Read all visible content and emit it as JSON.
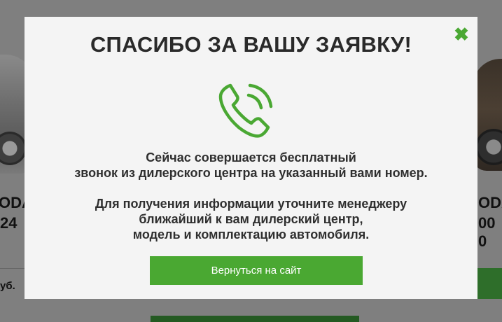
{
  "background": {
    "left_model": "ODA",
    "left_price": "24",
    "left_currency": "уб.",
    "right_model": "ODA",
    "right_price": "00 0"
  },
  "modal": {
    "title": "СПАСИБО ЗА ВАШУ ЗАЯВКУ!",
    "close_icon": "✖",
    "icon": "phone-call-icon",
    "message1_line1": "Сейчас совершается бесплатный",
    "message1_line2": "звонок из дилерского центра на указанный вами номер.",
    "message2_line1": "Для получения информации уточните менеджеру",
    "message2_line2": "ближайший к вам дилерский центр,",
    "message2_line3": "модель и комплектацию автомобиля.",
    "button_label": "Вернуться на сайт"
  },
  "colors": {
    "accent": "#4aa832",
    "modal_bg": "#f4f4f4",
    "overlay": "#7f7f7f"
  }
}
